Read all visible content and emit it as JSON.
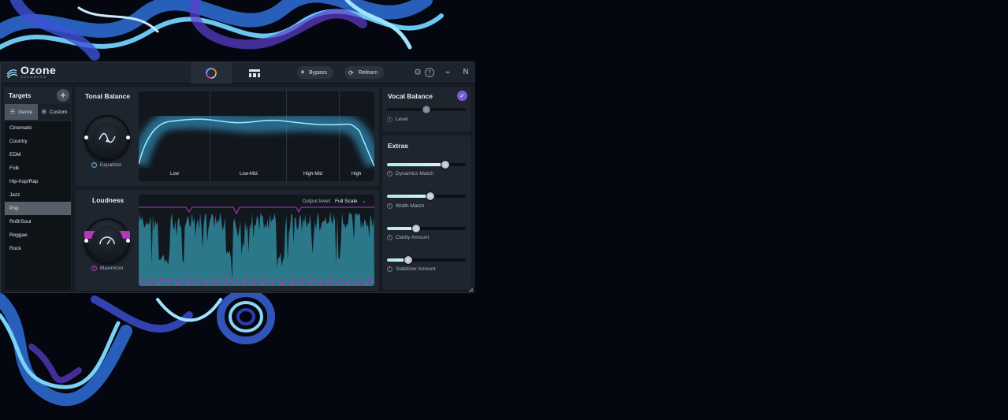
{
  "header": {
    "logo_name": "Ozone",
    "logo_sub": "ADVANCED",
    "tabs": [
      "assistant-icon",
      "modules-icon"
    ],
    "bypass_label": "Bypass",
    "relearn_label": "Relearn",
    "icons": [
      "gear-icon",
      "help-icon",
      "ai-icon",
      "ni-logo-icon"
    ]
  },
  "targets": {
    "title": "Targets",
    "segments": [
      "Genre",
      "Custom"
    ],
    "genres": [
      "Cinematic",
      "Country",
      "EDM",
      "Folk",
      "Hip-hop/Rap",
      "Jazz",
      "Pop",
      "RnB/Soul",
      "Reggae",
      "Rock"
    ],
    "selected_genre": "Pop"
  },
  "tonal_balance": {
    "title": "Tonal Balance",
    "knob_label": "Equalizer",
    "bands": [
      "Low",
      "Low-Mid",
      "High-Mid",
      "High"
    ]
  },
  "loudness": {
    "title": "Loudness",
    "knob_label": "Maximizer",
    "output_label": "Output level:",
    "output_value": "Full Scale"
  },
  "vocal_balance": {
    "title": "Vocal Balance",
    "level_label": "Level",
    "level_value": 0.5,
    "enabled": true
  },
  "extras": {
    "title": "Extras",
    "sliders": [
      {
        "label": "Dynamics Match",
        "value": 0.74
      },
      {
        "label": "Width Match",
        "value": 0.55
      },
      {
        "label": "Clarity Amount",
        "value": 0.37
      },
      {
        "label": "Stabilizer Amount",
        "value": 0.27
      }
    ]
  },
  "colors": {
    "accent_cyan": "#6fd3f2",
    "accent_purple": "#b03ab8",
    "check_purple": "#7a5bd6"
  }
}
